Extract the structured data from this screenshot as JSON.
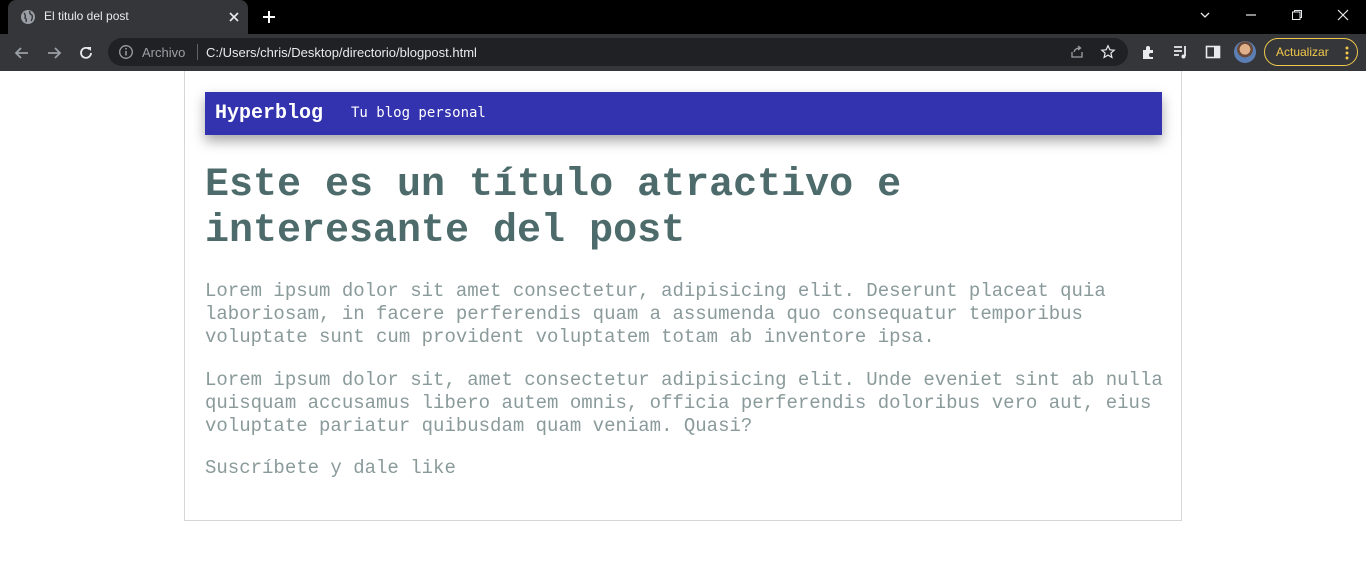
{
  "browser": {
    "tab": {
      "title": "El titulo del post",
      "favicon": "globe-icon"
    },
    "omnibox": {
      "scheme_label": "Archivo",
      "url": "C:/Users/chris/Desktop/directorio/blogpost.html"
    },
    "update_button": {
      "label": "Actualizar"
    },
    "accent_color": "#f2c94c"
  },
  "page": {
    "header": {
      "site_name": "Hyperblog",
      "tagline": "Tu blog personal",
      "background": "#3333b0"
    },
    "post": {
      "title": "Este es un título atractivo e interesante del post",
      "paragraphs": [
        "Lorem ipsum dolor sit amet consectetur, adipisicing elit. Deserunt placeat quia laboriosam, in facere perferendis quam a assumenda quo consequatur temporibus voluptate sunt cum provident voluptatem totam ab inventore ipsa.",
        "Lorem ipsum dolor sit, amet consectetur adipisicing elit. Unde eveniet sint ab nulla quisquam accusamus libero autem omnis, officia perferendis doloribus vero aut, eius voluptate pariatur quibusdam quam veniam. Quasi?",
        "Suscríbete y dale like"
      ]
    }
  }
}
